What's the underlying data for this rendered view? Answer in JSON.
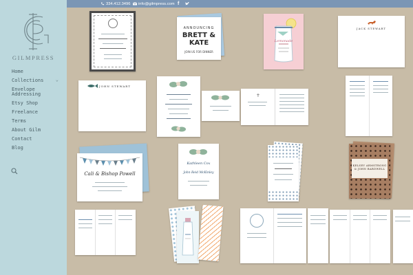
{
  "brand": {
    "name": "GILMPRESS"
  },
  "nav": {
    "items": [
      "Home",
      "Collections",
      "Envelope Addressing",
      "Etsy Shop",
      "Freelance",
      "Terms",
      "About Gilm",
      "Contact",
      "Blog"
    ]
  },
  "topbar": {
    "phone": "334.412.3496",
    "email": "info@gilmpress.com"
  },
  "cards": {
    "brett_top": "ANNOUNCING",
    "brett_names": "BRETT & KATE",
    "brett_bottom": "JOIN US FOR DINNER",
    "lemonade_text": "Lemonade",
    "jack_stewart_1": "JACK STEWART",
    "john_stewart": "JOHN STEWART",
    "cali_name": "Cali & Bishop Powell",
    "kathleen_name": "Kathleen Cox",
    "reid_name": "John Reid McKinley",
    "bunting_name": "KELSEY ARMSTRONG & JOHN BARDWELL"
  },
  "colors": {
    "sidebar": "#bcd8dd",
    "topbar": "#7b96b5",
    "gallery_bg": "#c8bca7",
    "accent_blue": "#9fc2d8",
    "kraft": "#a77e62"
  }
}
